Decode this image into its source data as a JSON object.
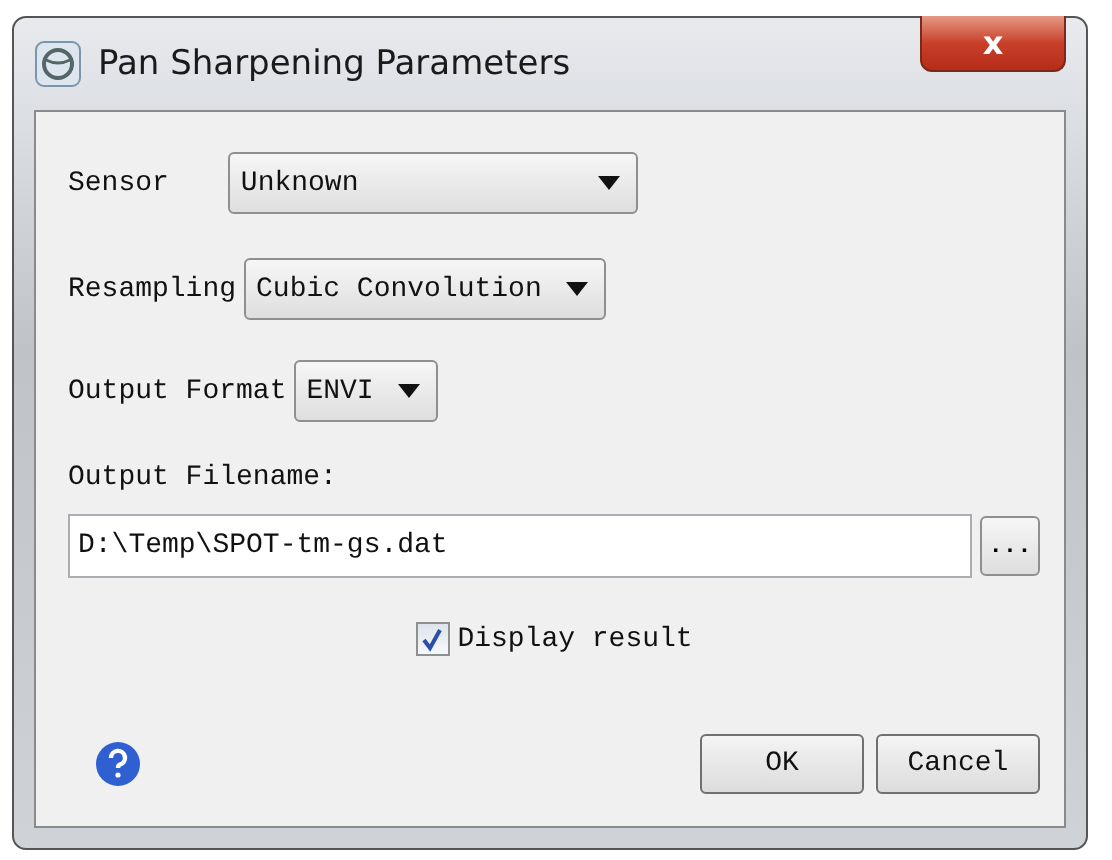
{
  "window": {
    "title": "Pan Sharpening Parameters",
    "close_label": "x"
  },
  "dropdowns": [
    {
      "label": "Sensor",
      "value": "Unknown"
    },
    {
      "label": "Resampling",
      "value": "Cubic Convolution"
    },
    {
      "label": "Output Format",
      "value": "ENVI"
    }
  ],
  "output_filename": {
    "label": "Output Filename:",
    "value": "D:\\Temp\\SPOT-tm-gs.dat",
    "browse_label": "..."
  },
  "display_result": {
    "label": "Display result",
    "checked": true
  },
  "buttons": [
    "OK",
    "Cancel"
  ]
}
